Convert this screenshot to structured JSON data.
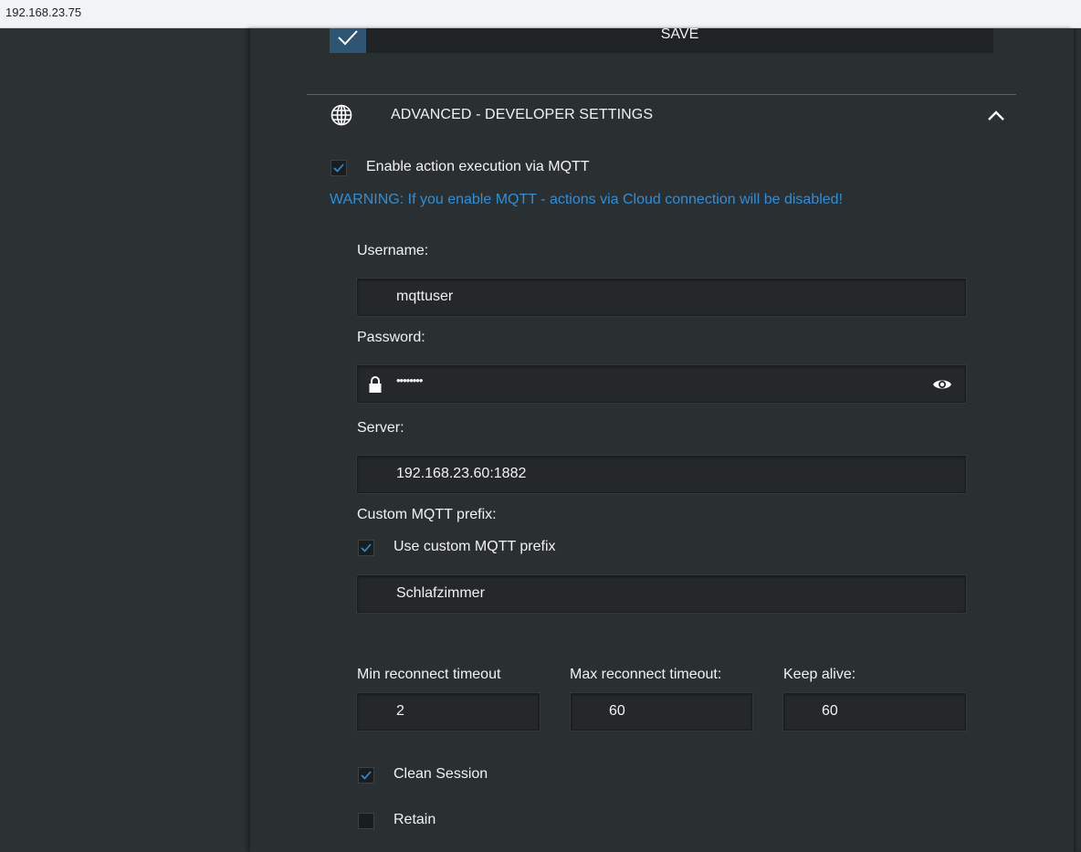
{
  "browser": {
    "address": "192.168.23.75"
  },
  "save": {
    "label": "SAVE"
  },
  "section": {
    "title": "ADVANCED - DEVELOPER SETTINGS"
  },
  "mqtt": {
    "enable_label": "Enable action execution via MQTT",
    "enable_checked": true,
    "warning": "WARNING: If you enable MQTT - actions via Cloud connection will be disabled!",
    "username_label": "Username:",
    "username_value": "mqttuser",
    "password_label": "Password:",
    "password_value": "••••••••",
    "server_label": "Server:",
    "server_value": "192.168.23.60:1882",
    "prefix_label": "Custom MQTT prefix:",
    "use_prefix_label": "Use custom MQTT prefix",
    "use_prefix_checked": true,
    "prefix_value": "Schlafzimmer",
    "min_reconnect_label": "Min reconnect timeout",
    "min_reconnect_value": "2",
    "max_reconnect_label": "Max reconnect timeout:",
    "max_reconnect_value": "60",
    "keep_alive_label": "Keep alive:",
    "keep_alive_value": "60",
    "clean_session_label": "Clean Session",
    "clean_session_checked": true,
    "retain_label": "Retain",
    "retain_checked": false
  },
  "icons": {
    "save": "check-icon",
    "section": "globe-icon",
    "collapse": "chevron-up-icon",
    "password_lock": "lock-icon",
    "password_toggle": "eye-icon"
  },
  "colors": {
    "background": "#2c3134",
    "panel": "#2a2f32",
    "accent": "#2f8fd8",
    "save_check_bg": "#2f5574",
    "text": "#f2f2f2"
  }
}
